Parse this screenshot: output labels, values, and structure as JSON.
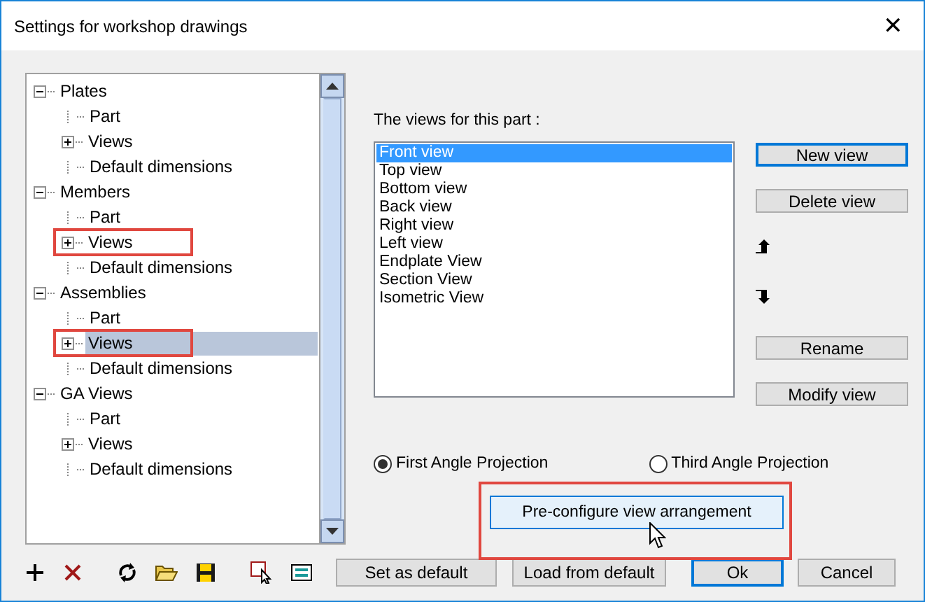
{
  "window": {
    "title": "Settings for workshop drawings",
    "close": "✕"
  },
  "tree": [
    {
      "label": "Plates",
      "kind": "folder",
      "expanded": true,
      "selected": false,
      "children": [
        {
          "label": "Part",
          "kind": "leaf",
          "selected": false,
          "highlighted": false
        },
        {
          "label": "Views",
          "kind": "folder",
          "expanded": false,
          "selected": false,
          "highlighted": false
        },
        {
          "label": "Default dimensions",
          "kind": "leaf",
          "selected": false,
          "highlighted": false
        }
      ]
    },
    {
      "label": "Members",
      "kind": "folder",
      "expanded": true,
      "selected": false,
      "children": [
        {
          "label": "Part",
          "kind": "leaf",
          "selected": false,
          "highlighted": false
        },
        {
          "label": "Views",
          "kind": "folder",
          "expanded": false,
          "selected": false,
          "highlighted": true
        },
        {
          "label": "Default dimensions",
          "kind": "leaf",
          "selected": false,
          "highlighted": false
        }
      ]
    },
    {
      "label": "Assemblies",
      "kind": "folder",
      "expanded": true,
      "selected": false,
      "children": [
        {
          "label": "Part",
          "kind": "leaf",
          "selected": false,
          "highlighted": false
        },
        {
          "label": "Views",
          "kind": "folder",
          "expanded": false,
          "selected": true,
          "highlighted": true
        },
        {
          "label": "Default dimensions",
          "kind": "leaf",
          "selected": false,
          "highlighted": false
        }
      ]
    },
    {
      "label": "GA Views",
      "kind": "folder",
      "expanded": true,
      "selected": false,
      "children": [
        {
          "label": "Part",
          "kind": "leaf",
          "selected": false,
          "highlighted": false
        },
        {
          "label": "Views",
          "kind": "folder",
          "expanded": false,
          "selected": false,
          "highlighted": false
        },
        {
          "label": "Default dimensions",
          "kind": "leaf",
          "selected": false,
          "highlighted": false
        }
      ]
    }
  ],
  "views_label": "The views for this part :",
  "views": [
    {
      "label": "Front view",
      "selected": true
    },
    {
      "label": "Top view",
      "selected": false
    },
    {
      "label": "Bottom view",
      "selected": false
    },
    {
      "label": "Back view",
      "selected": false
    },
    {
      "label": "Right view",
      "selected": false
    },
    {
      "label": "Left view",
      "selected": false
    },
    {
      "label": "Endplate View",
      "selected": false
    },
    {
      "label": "Section View",
      "selected": false
    },
    {
      "label": "Isometric View",
      "selected": false
    }
  ],
  "view_buttons": [
    {
      "kind": "button",
      "label": "New view",
      "default": true
    },
    {
      "kind": "button",
      "label": "Delete view",
      "default": false
    },
    {
      "kind": "up"
    },
    {
      "kind": "down"
    },
    {
      "kind": "button",
      "label": "Rename",
      "default": false
    },
    {
      "kind": "button",
      "label": "Modify view",
      "default": false
    }
  ],
  "projection": [
    {
      "label": "First Angle Projection",
      "selected": true
    },
    {
      "label": "Third Angle Projection",
      "selected": false
    }
  ],
  "preconfigure": {
    "label": "Pre-configure view arrangement",
    "highlighted": true
  },
  "toolbar": [
    {
      "kind": "add"
    },
    {
      "kind": "delete"
    },
    {
      "kind": "refresh"
    },
    {
      "kind": "open"
    },
    {
      "kind": "save"
    },
    {
      "kind": "select"
    },
    {
      "kind": "comment"
    }
  ],
  "buttons": [
    {
      "label": "Set as default",
      "default": false
    },
    {
      "label": "Load from default",
      "default": false
    },
    {
      "label": "Ok",
      "default": true
    },
    {
      "label": "Cancel",
      "default": false
    }
  ]
}
